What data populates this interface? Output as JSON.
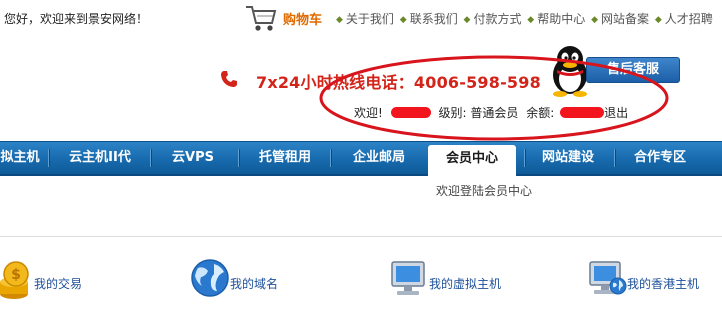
{
  "header": {
    "greeting": "您好，欢迎来到景安网络！",
    "cart_label": "购物车",
    "top_links": [
      "关于我们",
      "联系我们",
      "付款方式",
      "帮助中心",
      "网站备案",
      "人才招聘"
    ],
    "hotline": "7x24小时热线电话：4006-598-598",
    "service_button": "售后客服"
  },
  "user_info": {
    "welcome_label": "欢迎!",
    "level_label": "级别:",
    "level_value": "普通会员",
    "balance_label": "余额:",
    "logout_label": "退出"
  },
  "nav": {
    "items": [
      "拟主机",
      "云主机II代",
      "云VPS",
      "托管租用",
      "企业邮局",
      "会员中心",
      "网站建设",
      "合作专区"
    ],
    "active_index": 5
  },
  "subtitle": "欢迎登陆会员中心",
  "quick_links": [
    {
      "label": "我的交易",
      "icon": "coins-icon"
    },
    {
      "label": "我的域名",
      "icon": "globe-icon"
    },
    {
      "label": "我的虚拟主机",
      "icon": "computer-icon"
    },
    {
      "label": "我的香港主机",
      "icon": "computer-globe-icon"
    }
  ],
  "colors": {
    "nav_blue": "#176aad",
    "hotline_red": "#d3241a",
    "cart_orange": "#e06a00",
    "annotation_red": "#d8141c",
    "link_blue": "#1d4f9a"
  }
}
